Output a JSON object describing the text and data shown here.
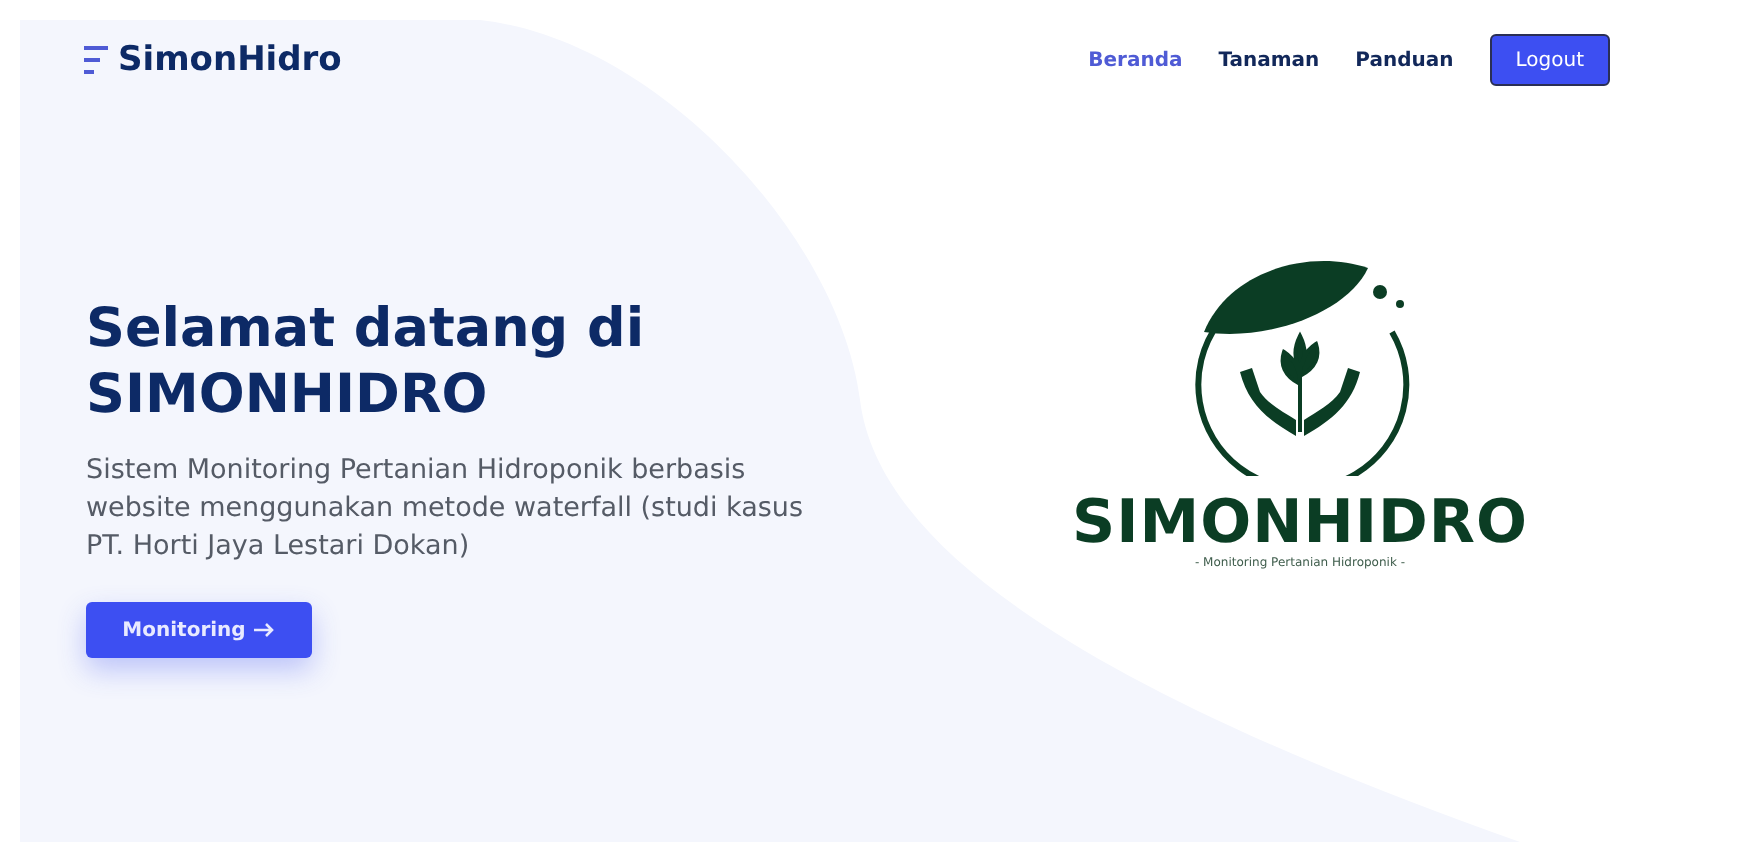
{
  "brand": {
    "name": "SimonHidro"
  },
  "nav": [
    {
      "label": "Beranda",
      "selected": true
    },
    {
      "label": "Tanaman",
      "selected": false
    },
    {
      "label": "Panduan",
      "selected": false
    }
  ],
  "logout_button": "Logout",
  "hero": {
    "title_lines": [
      "Selamat datang di",
      "SIMONHIDRO"
    ],
    "description": "Sistem Monitoring Pertanian Hidroponik berbasis website menggunakan metode waterfall (studi kasus PT. Horti Jaya Lestari Dokan)",
    "button": "Monitoring"
  },
  "logo": {
    "name": "SIMONHIDRO",
    "tagline": "- Monitoring Pertanian Hidroponik -"
  }
}
